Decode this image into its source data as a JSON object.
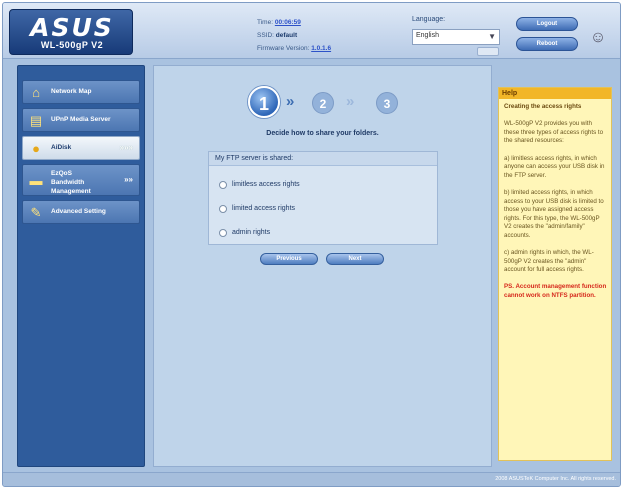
{
  "header": {
    "logo": "ASUS",
    "model": "WL-500gP V2",
    "time_label": "Time:",
    "time_value": "00:06:59",
    "ssid_label": "SSID:",
    "ssid_value": "default",
    "firmware_label": "Firmware Version:",
    "firmware_value": "1.0.1.6",
    "language_label": "Language:",
    "language_value": "English",
    "logout_label": "Logout",
    "reboot_label": "Reboot",
    "robot_icon": "robot-icon"
  },
  "sidebar": {
    "items": [
      {
        "label": "Network Map",
        "icon": "network-map-icon",
        "active": false
      },
      {
        "label": "UPnP Media Server",
        "icon": "media-server-icon",
        "active": false
      },
      {
        "label": "AiDisk",
        "icon": "aidisk-icon",
        "active": true,
        "arrow": "»»»"
      },
      {
        "label_lines": [
          "EzQoS",
          "Bandwidth",
          "Management"
        ],
        "icon": "bandwidth-icon",
        "active": false,
        "arrow": "»»"
      },
      {
        "label": "Advanced Setting",
        "icon": "advanced-setting-icon",
        "active": false
      }
    ]
  },
  "main": {
    "steps": [
      "1",
      "2",
      "3"
    ],
    "step_separator": "»",
    "instruction": "Decide how to share your folders.",
    "ftp_panel": {
      "title": "My FTP server is shared:",
      "options": [
        "limitless access rights",
        "limited access rights",
        "admin rights"
      ]
    },
    "previous_label": "Previous",
    "next_label": "Next"
  },
  "help": {
    "title": "Help",
    "heading": "Creating the access rights",
    "intro": "WL-500gP V2 provides you with these three types of access rights to the shared resources:",
    "para_a": "a) limitless access rights, in which anyone can access your USB disk in the FTP server.",
    "para_b": "b) limited access rights, in which access to your USB disk is limited to those you have assigned access rights. For this type, the WL-500gP V2 creates the \"admin/family\" accounts.",
    "para_c": "c) admin rights in which, the WL-500gP V2 creates the \"admin\" account for full access rights.",
    "warning": "PS. Account management function cannot work on NTFS partition."
  },
  "footer": {
    "copyright": "2008 ASUSTeK Computer Inc. All rights reserved."
  }
}
